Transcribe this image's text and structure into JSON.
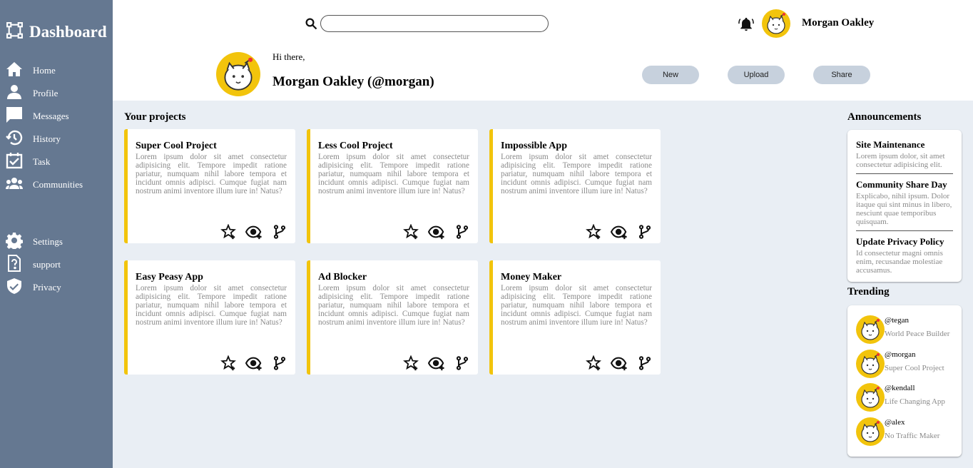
{
  "sidebar": {
    "brand": "Dashboard",
    "items": [
      {
        "label": "Home",
        "icon": "home-icon"
      },
      {
        "label": "Profile",
        "icon": "person-icon"
      },
      {
        "label": "Messages",
        "icon": "chat-icon"
      },
      {
        "label": "History",
        "icon": "history-icon"
      },
      {
        "label": "Task",
        "icon": "task-icon"
      },
      {
        "label": "Communities",
        "icon": "group-icon"
      }
    ],
    "bottom_items": [
      {
        "label": "Settings",
        "icon": "gear-icon"
      },
      {
        "label": "support",
        "icon": "help-icon"
      },
      {
        "label": "Privacy",
        "icon": "shield-icon"
      }
    ]
  },
  "header": {
    "search_placeholder": "",
    "username": "Morgan Oakley",
    "greeting": "Hi there,",
    "profile_name": "Morgan Oakley (@morgan)",
    "buttons": {
      "new": "New",
      "upload": "Upload",
      "share": "Share"
    }
  },
  "projects": {
    "title": "Your projects",
    "items": [
      {
        "title": "Super Cool Project",
        "description": "Lorem ipsum dolor sit amet consectetur adipisicing elit. Tempore impedit ratione pariatur, numquam nihil labore tempora et incidunt omnis adipisci. Cumque fugiat nam nostrum animi inventore illum iure in! Natus?"
      },
      {
        "title": "Less Cool Project",
        "description": "Lorem ipsum dolor sit amet consectetur adipisicing elit. Tempore impedit ratione pariatur, numquam nihil labore tempora et incidunt omnis adipisci. Cumque fugiat nam nostrum animi inventore illum iure in! Natus?"
      },
      {
        "title": "Impossible App",
        "description": "Lorem ipsum dolor sit amet consectetur adipisicing elit. Tempore impedit ratione pariatur, numquam nihil labore tempora et incidunt omnis adipisci. Cumque fugiat nam nostrum animi inventore illum iure in! Natus?"
      },
      {
        "title": "Easy Peasy App",
        "description": "Lorem ipsum dolor sit amet consectetur adipisicing elit. Tempore impedit ratione pariatur, numquam nihil labore tempora et incidunt omnis adipisci. Cumque fugiat nam nostrum animi inventore illum iure in! Natus?"
      },
      {
        "title": "Ad Blocker",
        "description": "Lorem ipsum dolor sit amet consectetur adipisicing elit. Tempore impedit ratione pariatur, numquam nihil labore tempora et incidunt omnis adipisci. Cumque fugiat nam nostrum animi inventore illum iure in! Natus?"
      },
      {
        "title": "Money Maker",
        "description": "Lorem ipsum dolor sit amet consectetur adipisicing elit. Tempore impedit ratione pariatur, numquam nihil labore tempora et incidunt omnis adipisci. Cumque fugiat nam nostrum animi inventore illum iure in! Natus?"
      }
    ]
  },
  "announcements": {
    "title": "Announcements",
    "items": [
      {
        "title": "Site Maintenance",
        "text": "Lorem ipsum dolor, sit amet consectetur adipisicing elit."
      },
      {
        "title": "Community Share Day",
        "text": "Explicabo, nihil ipsum. Dolor itaque qui sint minus in libero, nesciunt quae temporibus quisquam."
      },
      {
        "title": "Update Privacy Policy",
        "text": "Id consectetur magni omnis enim, recusandae molestiae accusamus."
      }
    ]
  },
  "trending": {
    "title": "Trending",
    "items": [
      {
        "user": "@tegan",
        "project": "World Peace Builder"
      },
      {
        "user": "@morgan",
        "project": "Super Cool Project"
      },
      {
        "user": "@kendall",
        "project": "Life Changing App"
      },
      {
        "user": "@alex",
        "project": "No Traffic Maker"
      }
    ]
  },
  "colors": {
    "sidebar": "#657891",
    "accent": "#f2c40c",
    "button": "#c7d1dd",
    "background": "#e9eef4"
  }
}
